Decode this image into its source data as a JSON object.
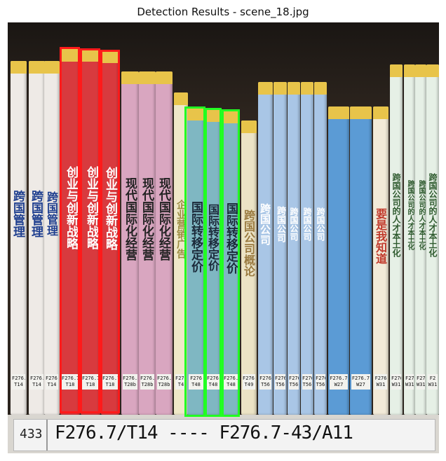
{
  "figure": {
    "title": "Detection Results - scene_18.jpg"
  },
  "colors": {
    "red_box": "#ff1a1a",
    "green_box": "#22ff22"
  },
  "books": [
    {
      "id": "b1",
      "title": "跨国管理",
      "call_no": "F276.7\nT14",
      "color": "#eeeae6",
      "text_color": "#1f3f8f"
    },
    {
      "id": "b2",
      "title": "跨国管理",
      "call_no": "F276.\nT14",
      "color": "#eeeae6",
      "text_color": "#1f3f8f"
    },
    {
      "id": "b3",
      "title": "跨国管理",
      "call_no": "F276.7\nT14",
      "color": "#eeeae6",
      "text_color": "#1f3f8f"
    },
    {
      "id": "b4",
      "title": "创业与创新战略",
      "call_no": "F276.7\nT18",
      "color": "#d83a3e",
      "text_color": "#ffffff"
    },
    {
      "id": "b5",
      "title": "创业与创新战略",
      "call_no": "F276.7\nT18",
      "color": "#d83a3e",
      "text_color": "#ffffff"
    },
    {
      "id": "b6",
      "title": "创业与创新战略",
      "call_no": "F276.7\nT18",
      "color": "#d83a3e",
      "text_color": "#ffffff"
    },
    {
      "id": "b7",
      "title": "现代国际化经营",
      "call_no": "F276.7\nT28b",
      "color": "#d9a6c0",
      "text_color": "#222222"
    },
    {
      "id": "b8",
      "title": "现代国际化经营",
      "call_no": "F276.7\nT28b",
      "color": "#d9a6c0",
      "text_color": "#222222"
    },
    {
      "id": "b9",
      "title": "现代国际化经营",
      "call_no": "F276.7\nT28b",
      "color": "#d9a6c0",
      "text_color": "#222222"
    },
    {
      "id": "b10",
      "title": "企业营销广告",
      "call_no": "F276.7\nT4",
      "color": "#efe8c8",
      "text_color": "#9a8a40"
    },
    {
      "id": "b11",
      "title": "国际转移定价",
      "call_no": "F276\nT48",
      "color": "#7fb7c2",
      "text_color": "#1b2a3a"
    },
    {
      "id": "b12",
      "title": "国际转移定价",
      "call_no": "F276.7\nT48",
      "color": "#7fb7c2",
      "text_color": "#1b2a3a"
    },
    {
      "id": "b13",
      "title": "国际转移定价",
      "call_no": "F276.7\nT48",
      "color": "#7fb7c2",
      "text_color": "#1b2a3a"
    },
    {
      "id": "b14",
      "title": "跨国公司概论",
      "call_no": "F276.7\nT49",
      "color": "#ece3c5",
      "text_color": "#9a7a40"
    },
    {
      "id": "b15",
      "title": "跨国公司",
      "call_no": "F276\nT56",
      "color": "#a9c6e6",
      "text_color": "#ffffff"
    },
    {
      "id": "b16",
      "title": "跨国公司",
      "call_no": "F276\nT56",
      "color": "#a9c6e6",
      "text_color": "#ffffff"
    },
    {
      "id": "b17",
      "title": "跨国公司",
      "call_no": "F276.7\nT56",
      "color": "#a9c6e6",
      "text_color": "#ffffff"
    },
    {
      "id": "b18",
      "title": "跨国公司",
      "call_no": "F276.7\nT56",
      "color": "#a9c6e6",
      "text_color": "#ffffff"
    },
    {
      "id": "b19",
      "title": "跨国公司",
      "call_no": "F276.7\nT56",
      "color": "#a9c6e6",
      "text_color": "#ffffff"
    },
    {
      "id": "b20",
      "title": "",
      "call_no": "F276.7\nW27",
      "color": "#5b9bd5",
      "text_color": "#ffffff"
    },
    {
      "id": "b21",
      "title": "",
      "call_no": "F276.7\nW27",
      "color": "#5b9bd5",
      "text_color": "#ffffff"
    },
    {
      "id": "b22",
      "title": "要是我知道",
      "call_no": "F276\nW31",
      "color": "#f2ead8",
      "text_color": "#c0392b"
    },
    {
      "id": "b23",
      "title": "跨国公司的人才本土化",
      "call_no": "F276.7\nW31",
      "color": "#e6f0e6",
      "text_color": "#2e5a2e"
    },
    {
      "id": "b24",
      "title": "跨国公司的人才本土化",
      "call_no": "F276\nW31",
      "color": "#e6f0e6",
      "text_color": "#2e5a2e"
    },
    {
      "id": "b25",
      "title": "跨国公司的人才本土化",
      "call_no": "F276\nW31",
      "color": "#e6f0e6",
      "text_color": "#2e5a2e"
    },
    {
      "id": "b26",
      "title": "跨国公司的人才本土化",
      "call_no": "F2\nW31",
      "color": "#e6f0e6",
      "text_color": "#2e5a2e"
    }
  ],
  "detections": [
    {
      "class_color": "red"
    },
    {
      "class_color": "red"
    },
    {
      "class_color": "red"
    },
    {
      "class_color": "green"
    },
    {
      "class_color": "green"
    },
    {
      "class_color": "green"
    }
  ],
  "shelf_label": {
    "number": "433",
    "range": "F276.7/T14 ---- F276.7-43/A11"
  }
}
